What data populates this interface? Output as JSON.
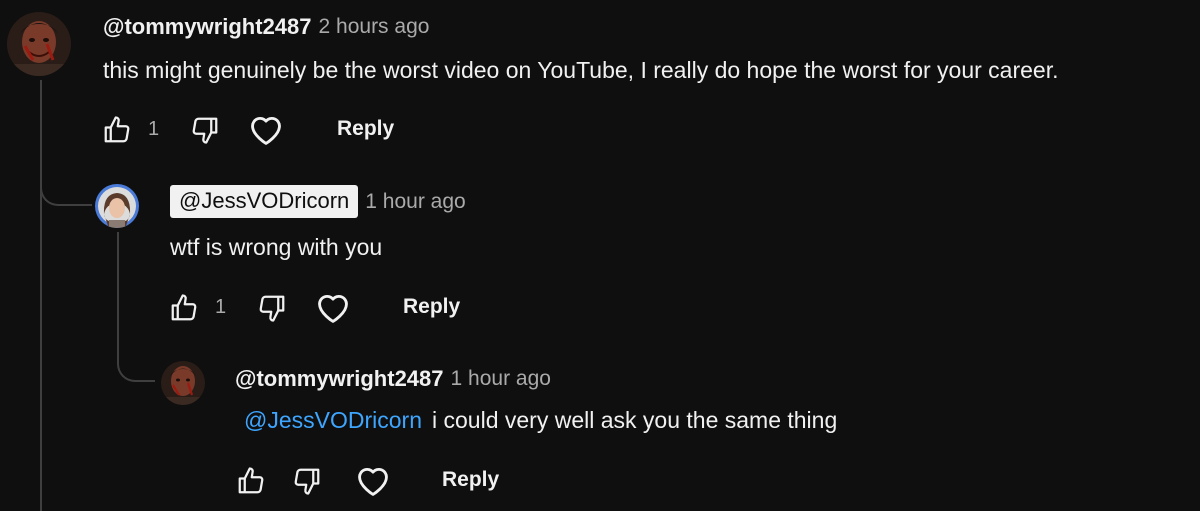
{
  "comments": [
    {
      "handle": "@tommywright2487",
      "time": "2 hours ago",
      "text": "this might genuinely be the worst video on YouTube,  I really do hope the worst for your career.",
      "likes": "1",
      "reply_label": "Reply"
    },
    {
      "handle": "@JessVODricorn",
      "time": "1 hour ago",
      "text": "wtf is wrong with you",
      "likes": "1",
      "reply_label": "Reply"
    },
    {
      "handle": "@tommywright2487",
      "time": "1 hour ago",
      "mention": "@JessVODricorn",
      "text": "i could very well ask you the same thing",
      "likes": "",
      "reply_label": "Reply"
    }
  ],
  "icons": {
    "like": "thumbs-up-icon",
    "dislike": "thumbs-down-icon",
    "heart": "heart-icon"
  },
  "colors": {
    "background": "#0f0f0f",
    "text": "#f1f1f1",
    "secondary_text": "#aaaaaa",
    "mention": "#3ea6ff",
    "thread_line": "#3f3f3f"
  }
}
